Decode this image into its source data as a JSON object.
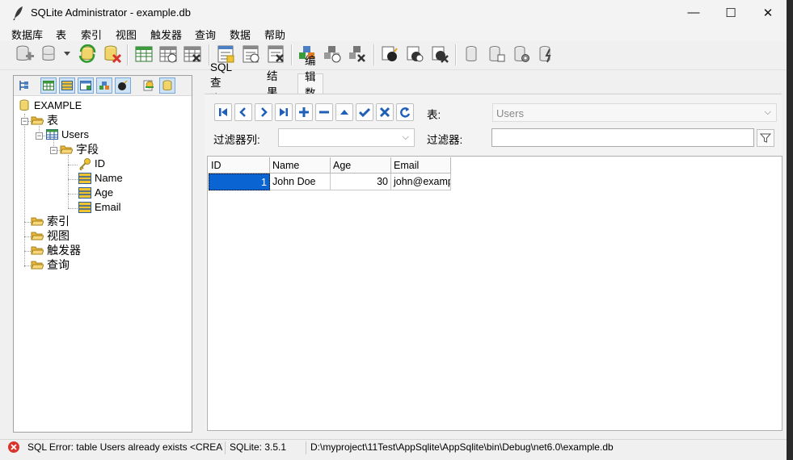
{
  "window": {
    "title": "SQLite Administrator - example.db",
    "minimize_glyph": "—",
    "maximize_glyph": "☐",
    "close_glyph": "✕"
  },
  "menu": [
    "数据库",
    "表",
    "索引",
    "视图",
    "触发器",
    "查询",
    "数据",
    "帮助"
  ],
  "toolbar_icons": [
    "new-database-icon",
    "open-database-icon",
    "dropdown-arrow-icon",
    "refresh-database-icon",
    "close-database-icon",
    "create-table-icon",
    "edit-table-icon",
    "delete-table-icon",
    "create-index-icon",
    "edit-index-icon",
    "delete-index-icon",
    "create-view-icon",
    "edit-view-icon",
    "delete-view-icon",
    "create-trigger-icon",
    "edit-trigger-icon",
    "delete-trigger-icon",
    "compact-database-icon",
    "export-database-icon",
    "database-settings-icon",
    "optimize-database-icon"
  ],
  "tree": {
    "root": "EXAMPLE",
    "tables_folder": "表",
    "table_name": "Users",
    "fields_folder": "字段",
    "fields": [
      "ID",
      "Name",
      "Age",
      "Email"
    ],
    "other_folders": [
      "索引",
      "视图",
      "触发器",
      "查询"
    ]
  },
  "tabs": [
    "SQL 查询",
    "结果",
    "编辑数据"
  ],
  "active_tab": "编辑数据",
  "editor": {
    "table_label": "表:",
    "table_value": "Users",
    "filter_column_label": "过滤器列:",
    "filter_column_value": "",
    "filter_label": "过滤器:",
    "filter_value": ""
  },
  "nav_icons": [
    "first-record-icon",
    "prev-record-icon",
    "next-record-icon",
    "last-record-icon",
    "insert-record-icon",
    "delete-record-icon",
    "edit-record-icon",
    "post-record-icon",
    "cancel-record-icon",
    "refresh-records-icon"
  ],
  "grid": {
    "columns": [
      "ID",
      "Name",
      "Age",
      "Email"
    ],
    "rows": [
      [
        "1",
        "John Doe",
        "30",
        "john@examp"
      ]
    ]
  },
  "status": {
    "error": "SQL Error: table Users already exists  <CREATE T",
    "version": "SQLite: 3.5.1",
    "path": "D:\\myproject\\11Test\\AppSqlite\\AppSqlite\\bin\\Debug\\net6.0\\example.db"
  },
  "colors": {
    "selection": "#0a64d1",
    "folder": "#f2c14e",
    "error": "#d9342b"
  }
}
